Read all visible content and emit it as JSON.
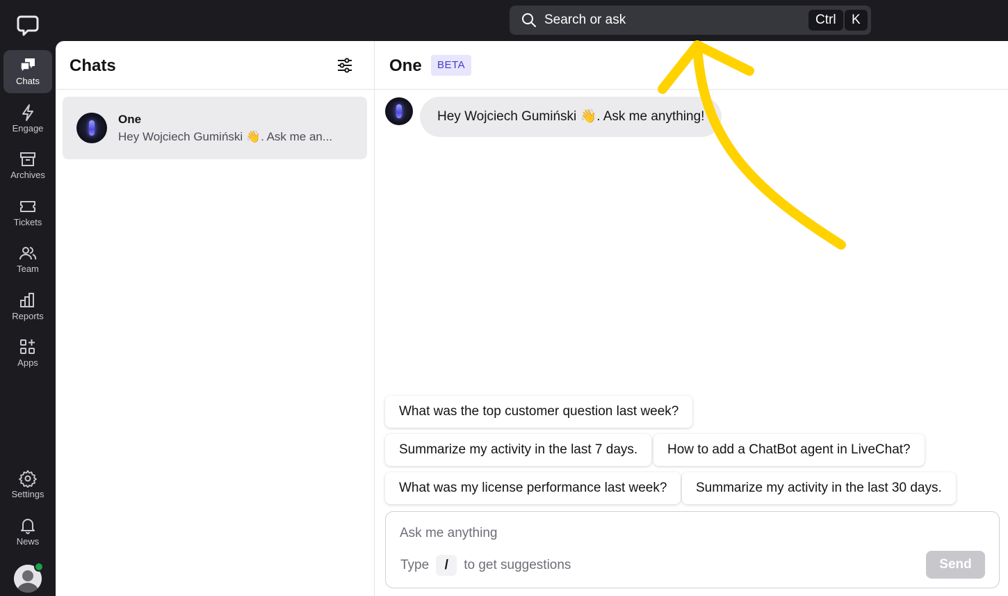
{
  "topbar": {
    "search_placeholder": "Search or ask",
    "shortcut_ctrl": "Ctrl",
    "shortcut_key": "K"
  },
  "sidebar": {
    "items": [
      {
        "label": "Chats",
        "icon": "chats-icon",
        "active": true
      },
      {
        "label": "Engage",
        "icon": "lightning-icon"
      },
      {
        "label": "Archives",
        "icon": "archive-icon"
      },
      {
        "label": "Tickets",
        "icon": "ticket-icon"
      },
      {
        "label": "Team",
        "icon": "team-icon"
      },
      {
        "label": "Reports",
        "icon": "reports-icon"
      },
      {
        "label": "Apps",
        "icon": "apps-icon"
      }
    ],
    "bottom_items": [
      {
        "label": "Settings",
        "icon": "gear-icon"
      },
      {
        "label": "News",
        "icon": "bell-icon"
      }
    ]
  },
  "chats_panel": {
    "title": "Chats",
    "items": [
      {
        "name": "One",
        "preview": "Hey Wojciech Gumiński 👋. Ask me an..."
      }
    ]
  },
  "conversation": {
    "title": "One",
    "badge": "BETA",
    "messages": [
      {
        "text": "Hey Wojciech Gumiński 👋. Ask me anything!"
      }
    ],
    "suggestions": [
      "What was the top customer question last week?",
      "Summarize my activity in the last 7 days.",
      "How to add a ChatBot agent in LiveChat?",
      "What was my license performance last week?",
      "Summarize my activity in the last 30 days."
    ],
    "composer": {
      "placeholder": "Ask me anything",
      "hint_before": "Type",
      "hint_key": "/",
      "hint_after": "to get suggestions",
      "send_label": "Send"
    }
  },
  "colors": {
    "arrow": "#ffd200",
    "badge_bg": "#e8e6fd",
    "badge_text": "#4a39c9",
    "online": "#18a24a"
  }
}
